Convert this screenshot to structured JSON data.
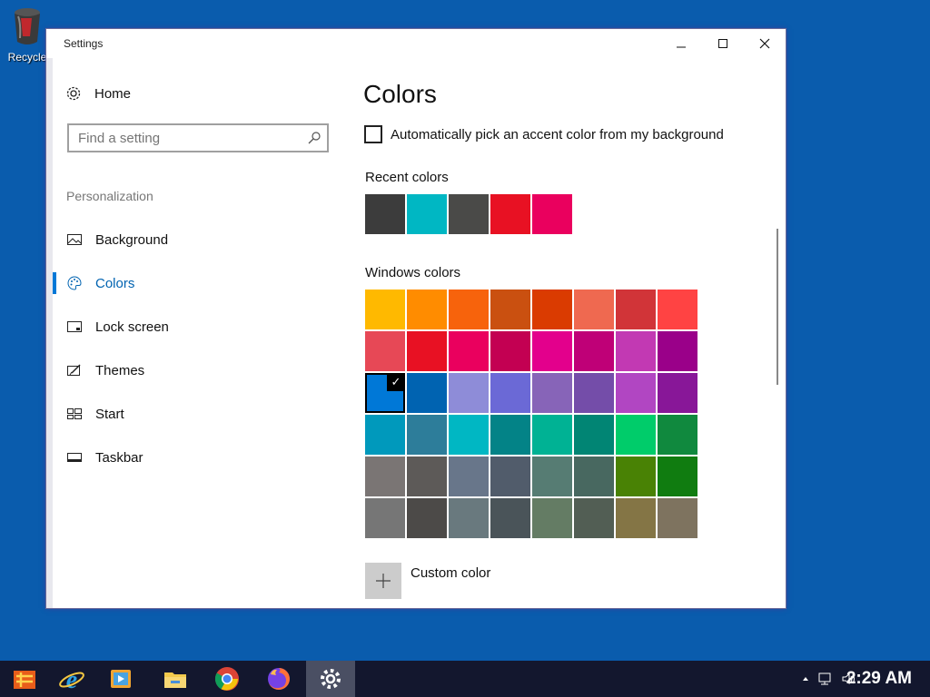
{
  "desktop": {
    "recycle_label": "Recycle"
  },
  "window": {
    "title": "Settings"
  },
  "sidebar": {
    "home_label": "Home",
    "search_placeholder": "Find a setting",
    "section_header": "Personalization",
    "items": [
      {
        "label": "Background",
        "icon": "background-icon"
      },
      {
        "label": "Colors",
        "icon": "palette-icon",
        "active": true
      },
      {
        "label": "Lock screen",
        "icon": "lock-screen-icon"
      },
      {
        "label": "Themes",
        "icon": "themes-icon"
      },
      {
        "label": "Start",
        "icon": "start-icon"
      },
      {
        "label": "Taskbar",
        "icon": "taskbar-icon"
      }
    ]
  },
  "main": {
    "title": "Colors",
    "auto_pick_label": "Automatically pick an accent color from my background",
    "auto_pick_checked": false,
    "recent_header": "Recent colors",
    "recent_colors": [
      "#3c3c3c",
      "#00b7c3",
      "#4a4a48",
      "#e81123",
      "#ea005e"
    ],
    "windows_header": "Windows colors",
    "windows_colors": [
      [
        "#ffb900",
        "#ff8c00",
        "#f7630c",
        "#ca5010",
        "#da3b01",
        "#ef6950",
        "#d13438",
        "#ff4343"
      ],
      [
        "#e74856",
        "#e81123",
        "#ea005e",
        "#c30052",
        "#e3008c",
        "#bf0077",
        "#c239b3",
        "#9a0089"
      ],
      [
        "#0078d7",
        "#0063b1",
        "#8e8cd8",
        "#6b69d6",
        "#8764b8",
        "#744da9",
        "#b146c2",
        "#881798"
      ],
      [
        "#0099bc",
        "#2d7d9a",
        "#00b7c3",
        "#038387",
        "#00b294",
        "#018574",
        "#00cc6a",
        "#10893e"
      ],
      [
        "#7a7574",
        "#5d5a58",
        "#68768a",
        "#515c6b",
        "#567c73",
        "#486860",
        "#498205",
        "#107c10"
      ],
      [
        "#767676",
        "#4c4a48",
        "#69797e",
        "#4a5459",
        "#647c64",
        "#525e54",
        "#847545",
        "#7e735f"
      ]
    ],
    "selected_color": "#0078d7",
    "custom_color_label": "Custom color"
  },
  "taskbar": {
    "apps": [
      "start-icon",
      "internet-explorer-icon",
      "media-player-icon",
      "file-explorer-icon",
      "chrome-icon",
      "firefox-icon",
      "settings-icon"
    ],
    "active_app": "settings-icon",
    "clock": "2:29 AM"
  }
}
